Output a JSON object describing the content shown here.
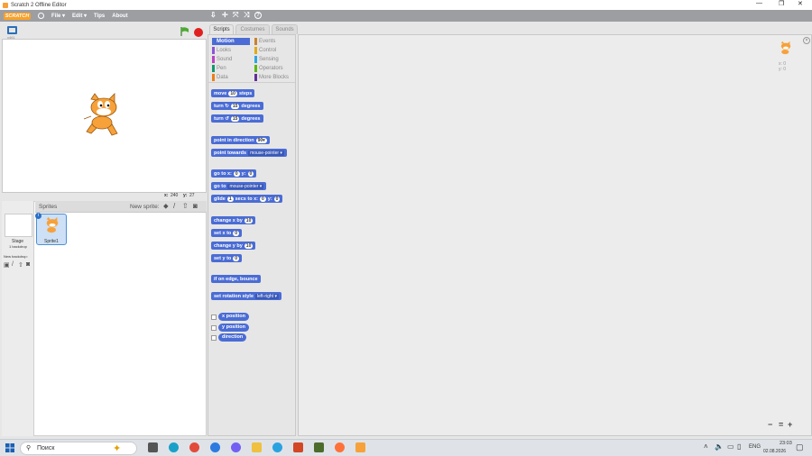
{
  "window": {
    "title": "Scratch 2 Offline Editor"
  },
  "menubar": {
    "logo": "SCRATCH",
    "items": [
      "File ▾",
      "Edit ▾",
      "Tips",
      "About"
    ]
  },
  "stage": {
    "version": "v461",
    "coords": {
      "x_label": "x:",
      "x": "240",
      "y_label": "y:",
      "y": "27"
    }
  },
  "sprites": {
    "header": "Sprites",
    "new_sprite": "New sprite:",
    "stage_label": "Stage",
    "backdrop_count": "1 backdrop",
    "new_backdrop": "New backdrop:",
    "sprite_name": "Sprite1"
  },
  "tabs": [
    "Scripts",
    "Costumes",
    "Sounds"
  ],
  "categories": [
    {
      "name": "Motion",
      "color": "#4a6cd4"
    },
    {
      "name": "Events",
      "color": "#c88330"
    },
    {
      "name": "Looks",
      "color": "#8a55d7"
    },
    {
      "name": "Control",
      "color": "#e1a91a"
    },
    {
      "name": "Sound",
      "color": "#bb42c3"
    },
    {
      "name": "Sensing",
      "color": "#2ca5e2"
    },
    {
      "name": "Pen",
      "color": "#0e9a6c"
    },
    {
      "name": "Operators",
      "color": "#5cb712"
    },
    {
      "name": "Data",
      "color": "#ee7d16"
    },
    {
      "name": "More Blocks",
      "color": "#632d99"
    }
  ],
  "blocks": {
    "move": [
      "move",
      "10",
      "steps"
    ],
    "turn_right": [
      "turn ↻",
      "15",
      "degrees"
    ],
    "turn_left": [
      "turn ↺",
      "15",
      "degrees"
    ],
    "point_dir": [
      "point in direction",
      "90▾"
    ],
    "point_towards": [
      "point towards",
      "mouse-pointer ▾"
    ],
    "goto_xy": [
      "go to x:",
      "0",
      "y:",
      "0"
    ],
    "goto": [
      "go to",
      "mouse-pointer ▾"
    ],
    "glide": [
      "glide",
      "1",
      "secs to x:",
      "0",
      "y:",
      "0"
    ],
    "change_x": [
      "change x by",
      "10"
    ],
    "set_x": [
      "set x to",
      "0"
    ],
    "change_y": [
      "change y by",
      "10"
    ],
    "set_y": [
      "set y to",
      "0"
    ],
    "bounce": [
      "if on edge, bounce"
    ],
    "rot_style": [
      "set rotation style",
      "left-right ▾"
    ],
    "reporters": [
      "x position",
      "y position",
      "direction"
    ]
  },
  "sprite_info": {
    "x": "x: 0",
    "y": "y: 0"
  },
  "zoom": {
    "out": "−",
    "reset": "=",
    "in": "+"
  },
  "taskbar": {
    "search": "Поиск",
    "lang": "ENG",
    "time": "23:03",
    "date": "02.08.2026"
  }
}
